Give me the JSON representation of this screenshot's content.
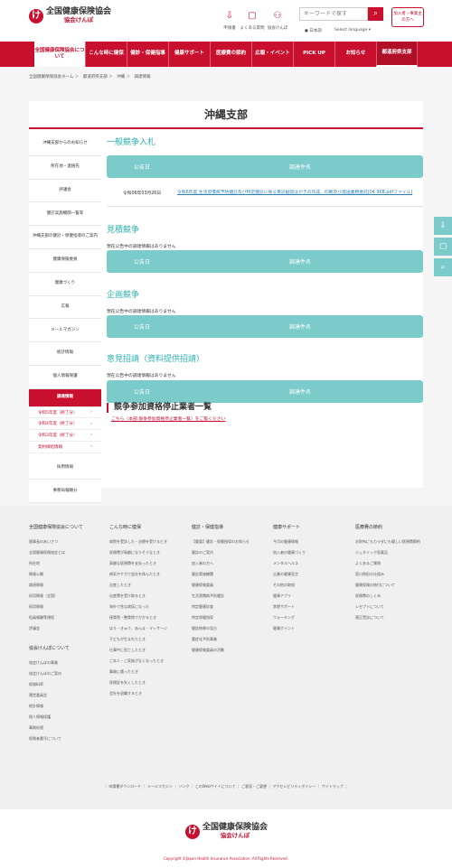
{
  "header": {
    "logo_main": "全国健康保険協会",
    "logo_sub": "協会けんぽ",
    "icons": [
      {
        "icon": "download-icon",
        "label": "申請書"
      },
      {
        "icon": "chat-icon",
        "label": "よくある質問"
      },
      {
        "icon": "people-icon",
        "label": "協会けんぽ"
      }
    ],
    "search_placeholder": "キーワードで探す",
    "lang_ja": "日本語",
    "lang_select": "Select language",
    "login_label": "加入者・事業主の方へ"
  },
  "gnav": [
    "全国健康保険協会について",
    "こんな時に健保",
    "健診・保健指導",
    "健康サポート",
    "医療費の節約",
    "広報・イベント",
    "PICK UP",
    "お知らせ",
    "都道府県支部"
  ],
  "breadcrumb": [
    "全国健康保険協会ホーム",
    "都道府県支部",
    "沖縄",
    "調達情報"
  ],
  "page_title": "沖縄支部",
  "sidebar": {
    "items_top": [
      "沖縄支部からのお知らせ",
      "所在地・連絡先",
      "評議会",
      "健診実施機関一覧等",
      "沖縄支部の健診・保健指導のご案内",
      "健康保険委員",
      "健康づくり",
      "広報",
      "メールマガジン",
      "統計情報",
      "個人情報保護"
    ],
    "active": "調達情報",
    "subs": [
      "令和5年度（終了分）",
      "令和4年度（終了分）",
      "令和3年度（終了分）",
      "契約締結情報"
    ],
    "items_bottom": [
      "採用情報",
      "事務局報酬分"
    ]
  },
  "sections": [
    {
      "title": "一般競争入札",
      "col1": "公告日",
      "col2": "調達件名",
      "rows": [
        {
          "date": "令和06年03月26日",
          "title": "令和6年度 生活習慣病予防健診及び特定健診に係る受診勧奨はがきの作成、印刷及び発送業務委託[04.9KB.pdfファイル]"
        }
      ]
    },
    {
      "title": "見積競争",
      "none": "現在公告中の調達情報はありません",
      "col1": "公告日",
      "col2": "調達件名"
    },
    {
      "title": "企画競争",
      "none": "現在公告中の調達情報はありません",
      "col1": "公告日",
      "col2": "調達件名"
    },
    {
      "title": "意見招請（資料提供招請）",
      "none": "現在公告中の調達情報はありません",
      "col1": "公告日",
      "col2": "調達件名"
    }
  ],
  "stop": {
    "title": "競争参加資格停止業者一覧",
    "link": "こちら（本部:競争参加資格停止業者一覧）をご覧ください"
  },
  "footer": {
    "cols": [
      {
        "title": "全国健康保険協会について",
        "links": [
          "理事長のあいさつ",
          "全国健康保険協会とは",
          "所在地",
          "情報公開",
          "調達情報",
          "採用情報（全国）",
          "採用情報",
          "役員報酬等規程",
          "評議会",
          "統計情報",
          "健康保険法等について"
        ],
        "sub_title": "協会けんぽについて",
        "sub_links": [
          "協会けんぽの事業",
          "協会けんぽのご案内",
          "保険料率",
          "運営委員会",
          "統計情報",
          "個人情報保護",
          "事務処理",
          "保険者番号について"
        ]
      },
      {
        "title": "こんな時に健保",
        "links": [
          "病院を受診した・治療を受けるとき",
          "医療費が高額になりそうなとき",
          "高額な医療費を支払ったとき",
          "病気やケガで会社を休んだとき",
          "出産したとき",
          "出産費を受け取るとき",
          "海外で急な病気になった",
          "接骨院・整骨院でかかるとき",
          "はり・きゅう、あんま・マッサージ",
          "子どもが生まれたとき",
          "仕事中に死亡したとき",
          "ご本人・ご家族がなくなったとき",
          "事故に遭ったとき",
          "保険証を失くしたとき",
          "会社を退職するとき"
        ]
      },
      {
        "title": "健診・保健指導",
        "links": [
          "【重要】健診・保健指導のお知らせ",
          "健診のご案内",
          "加入者の方へ",
          "健診実施機関",
          "健康保険委員",
          "生活習慣病予防健診",
          "特定健康診査",
          "特定保健指導",
          "健診結果の見方",
          "重症化予防事業",
          "健康保険委員の活動"
        ]
      },
      {
        "title": "健康サポート",
        "links": [
          "今月の健康情報",
          "加入者の健康づくり",
          "メンタルヘルス",
          "企業の健康宣言",
          "その他の取組",
          "健康アプリ",
          "禁煙サポート",
          "ウォーキング",
          "健康ポイント"
        ]
      },
      {
        "title": "医療費の節約",
        "links": [
          "お財布にもカラダにも優しい医療費節約",
          "ジェネリック医薬品",
          "よくあるご質問",
          "窓口負担の仕組み",
          "健康保険の給付について",
          "医療費のしくみ",
          "レセプトについて",
          "適正受診について"
        ]
      }
    ],
    "bottom_links": "｜ 申請書ダウンロード ｜ メールマガジン ｜ リンク ｜ このWebサイトについて ｜ ご意見・ご要望 ｜ アクセシビリティポリシー ｜ サイトマップ ｜",
    "copyright": "Copyright ©Japan Health Insurance Association. All Rights Reserved.",
    "logo_main": "全国健康保険協会",
    "logo_sub": "協会けんぽ"
  },
  "colors": {
    "brand": "#c8102e",
    "accent": "#7ccbcb",
    "link": "#2a7fb8"
  }
}
